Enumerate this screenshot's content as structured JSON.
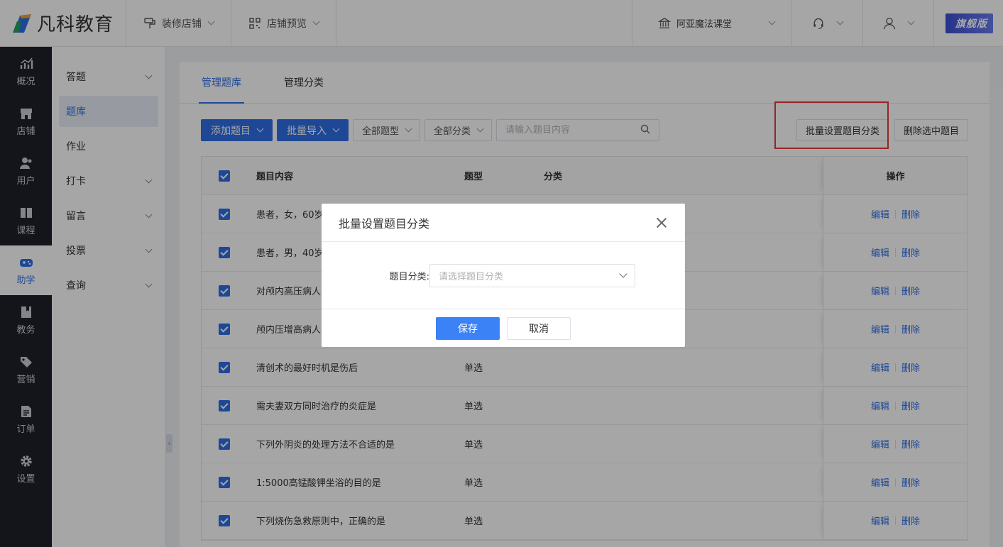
{
  "brand": {
    "name": "凡科教育"
  },
  "topbar": {
    "decorate_store": "装修店铺",
    "store_preview": "店铺预览",
    "store_name": "阿亚魔法课堂",
    "edition_badge": "旗舰版",
    "icons": [
      "decorate-brush-icon",
      "qr-grid-icon",
      "bank-icon",
      "headset-icon",
      "user-icon"
    ]
  },
  "rail": {
    "items": [
      {
        "label": "概况",
        "icon": "chart-icon"
      },
      {
        "label": "店铺",
        "icon": "shop-icon"
      },
      {
        "label": "用户",
        "icon": "users-icon"
      },
      {
        "label": "课程",
        "icon": "book-icon"
      },
      {
        "label": "助学",
        "icon": "gamepad-icon",
        "active": true
      },
      {
        "label": "教务",
        "icon": "clipboard-icon"
      },
      {
        "label": "营销",
        "icon": "tag-icon"
      },
      {
        "label": "订单",
        "icon": "order-icon"
      },
      {
        "label": "设置",
        "icon": "gear-icon"
      }
    ]
  },
  "submenu": {
    "items": [
      {
        "label": "答题",
        "expandable": true
      },
      {
        "label": "题库",
        "active": true
      },
      {
        "label": "作业"
      },
      {
        "label": "打卡",
        "expandable": true
      },
      {
        "label": "留言",
        "expandable": true
      },
      {
        "label": "投票",
        "expandable": true
      },
      {
        "label": "查询",
        "expandable": true
      }
    ]
  },
  "tabs": [
    {
      "label": "管理题库",
      "active": true
    },
    {
      "label": "管理分类"
    }
  ],
  "toolbar": {
    "add_question": "添加题目",
    "batch_import": "批量导入",
    "all_types": "全部题型",
    "all_categories": "全部分类",
    "search_placeholder": "请输入题目内容",
    "batch_set_category": "批量设置题目分类",
    "delete_selected": "删除选中题目"
  },
  "table": {
    "headers": {
      "content": "题目内容",
      "type": "题型",
      "category": "分类",
      "ops": "操作"
    },
    "edit_label": "编辑",
    "delete_label": "删除",
    "rows": [
      {
        "content": "患者，女，60岁",
        "type": "",
        "category": ""
      },
      {
        "content": "患者，男，40岁",
        "type": "",
        "category": ""
      },
      {
        "content": "对颅内高压病人",
        "type": "",
        "category": ""
      },
      {
        "content": "颅内压增高病人",
        "type": "",
        "category": ""
      },
      {
        "content": "清创术的最好时机是伤后",
        "type": "单选",
        "category": ""
      },
      {
        "content": "需夫妻双方同时治疗的炎症是",
        "type": "单选",
        "category": ""
      },
      {
        "content": "下列外阴炎的处理方法不合适的是",
        "type": "单选",
        "category": ""
      },
      {
        "content": "1:5000高锰酸钾坐浴的目的是",
        "type": "单选",
        "category": ""
      },
      {
        "content": "下列烧伤急救原则中，正确的是",
        "type": "单选",
        "category": ""
      }
    ]
  },
  "dialog": {
    "title": "批量设置题目分类",
    "field_label": "题目分类:",
    "select_placeholder": "请选择题目分类",
    "save": "保存",
    "cancel": "取消"
  },
  "colors": {
    "primary": "#2f6fe6",
    "highlight": "#e23b3b",
    "rail_bg": "#1e2129"
  }
}
